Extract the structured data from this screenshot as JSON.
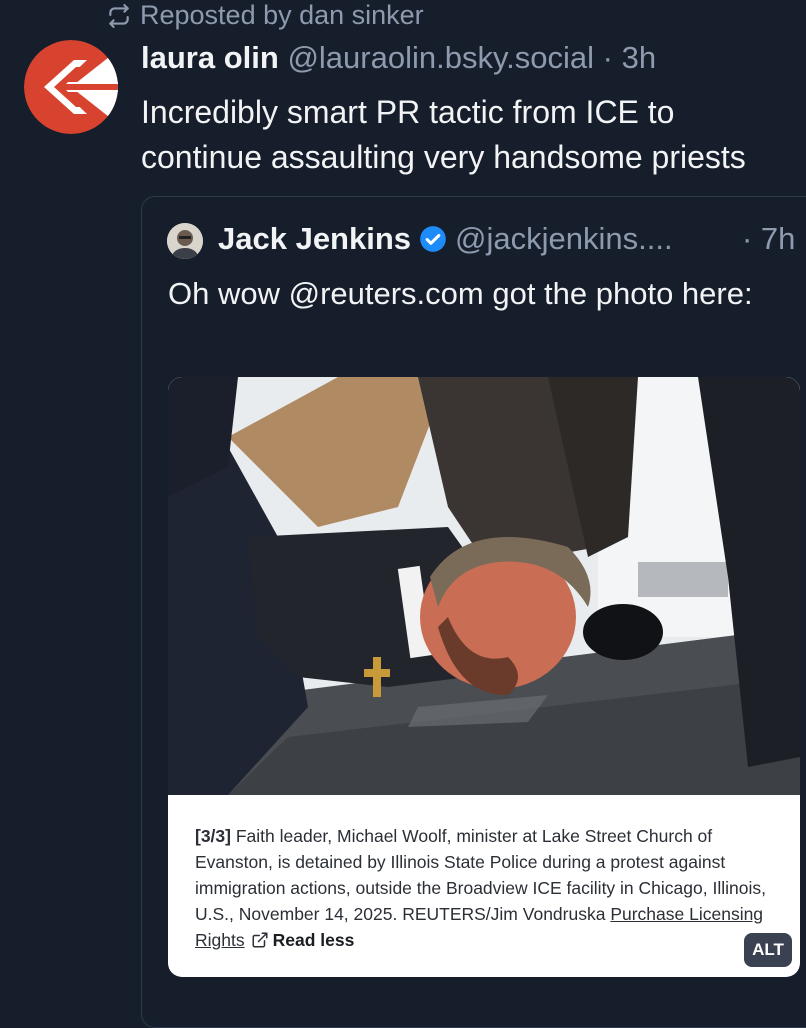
{
  "repost": {
    "label": "Reposted by dan sinker",
    "icon": "repost-icon"
  },
  "post": {
    "author_name": "laura olin",
    "author_handle": "@lauraolin.bsky.social",
    "separator": "·",
    "time": "3h",
    "text_line1": "Incredibly smart PR tactic from ICE to",
    "text_line2": "continue assaulting very handsome priests",
    "avatar_icon": "arrow-logo-avatar",
    "avatar_colors": {
      "primary": "#d8432f",
      "secondary": "#ffffff"
    }
  },
  "quote": {
    "author_name": "Jack Jenkins",
    "author_handle": "@jackjenkins....",
    "time": "· 7h",
    "verified_icon": "verified-check-icon",
    "verified_color": "#1d8cf8",
    "text": "Oh wow @reuters.com got the photo here:",
    "embed": {
      "photo_alt": "photo-protest-arrest",
      "caption_index": "[3/3]",
      "caption_text": " Faith leader, Michael Woolf, minister at Lake Street Church of Evanston, is detained by Illinois State Police during a protest against immigration actions, outside the Broadview ICE facility in Chicago, Illinois, U.S., November 14, 2025. REUTERS/Jim Vondruska ",
      "caption_link": "Purchase Licensing Rights",
      "external_icon": "external-link-icon",
      "read_less": "Read less",
      "alt_badge": "ALT"
    }
  },
  "colors": {
    "background": "#161e2b",
    "text_primary": "#f1f3f5",
    "text_muted": "#8e9bae",
    "border": "#2e3a4c"
  }
}
